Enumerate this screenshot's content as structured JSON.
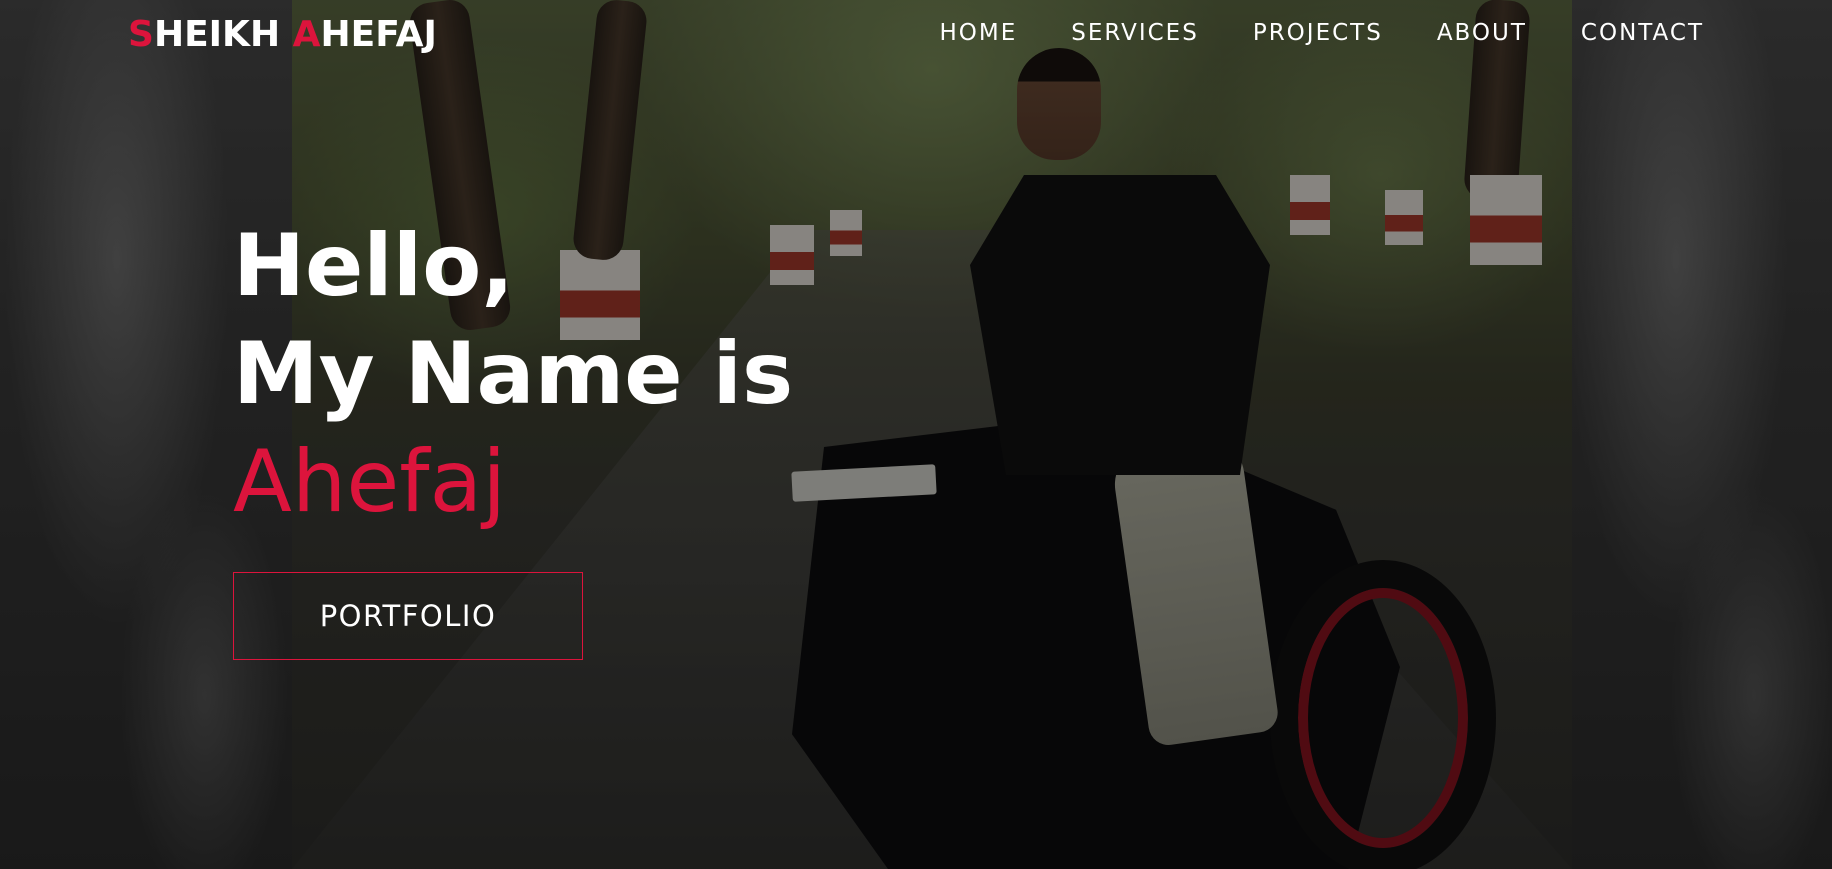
{
  "brand": {
    "first_initial": "S",
    "first_rest": "HEIKH ",
    "second_initial": "A",
    "second_rest": "HEFAJ"
  },
  "nav": {
    "items": [
      {
        "label": "HOME"
      },
      {
        "label": "SERVICES"
      },
      {
        "label": "PROJECTS"
      },
      {
        "label": "ABOUT"
      },
      {
        "label": "CONTACT"
      }
    ]
  },
  "hero": {
    "greeting": "Hello,",
    "intro": "My Name is",
    "name": "Ahefaj",
    "cta_label": "PORTFOLIO"
  },
  "colors": {
    "accent": "#dc143c",
    "text": "#ffffff"
  }
}
